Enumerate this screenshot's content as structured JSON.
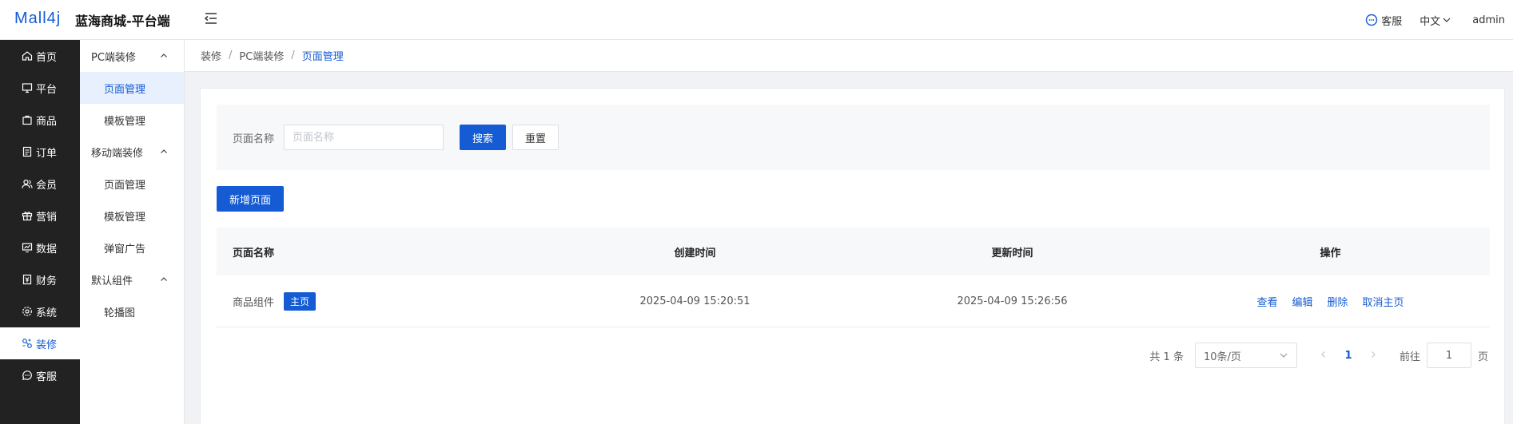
{
  "header": {
    "logo_text": "Mall4j",
    "app_title": "蓝海商城-平台端",
    "service_label": "客服",
    "language_label": "中文",
    "user_label": "admin"
  },
  "sidebar": {
    "items": [
      {
        "label": "首页",
        "icon": "home-icon"
      },
      {
        "label": "平台",
        "icon": "monitor-icon"
      },
      {
        "label": "商品",
        "icon": "bag-icon"
      },
      {
        "label": "订单",
        "icon": "document-icon"
      },
      {
        "label": "会员",
        "icon": "users-icon"
      },
      {
        "label": "营销",
        "icon": "gift-icon"
      },
      {
        "label": "数据",
        "icon": "chart-icon"
      },
      {
        "label": "财务",
        "icon": "ledger-icon"
      },
      {
        "label": "系统",
        "icon": "gear-icon"
      },
      {
        "label": "装修",
        "icon": "decorate-icon",
        "active": true
      },
      {
        "label": "客服",
        "icon": "chat-icon"
      }
    ]
  },
  "submenu": {
    "groups": [
      {
        "title": "PC端装修",
        "items": [
          "页面管理",
          "模板管理"
        ]
      },
      {
        "title": "移动端装修",
        "items": [
          "页面管理",
          "模板管理",
          "弹窗广告"
        ]
      },
      {
        "title": "默认组件",
        "items": [
          "轮播图"
        ]
      }
    ]
  },
  "breadcrumb": {
    "items": [
      "装修",
      "PC端装修",
      "页面管理"
    ],
    "separator": "/"
  },
  "search": {
    "label": "页面名称",
    "placeholder": "页面名称",
    "search_button": "搜索",
    "reset_button": "重置"
  },
  "add_button": "新增页面",
  "table": {
    "headers": [
      "页面名称",
      "创建时间",
      "更新时间",
      "操作"
    ],
    "rows": [
      {
        "name": "商品组件",
        "tag": "主页",
        "created": "2025-04-09 15:20:51",
        "updated": "2025-04-09 15:26:56",
        "actions": [
          "查看",
          "编辑",
          "删除",
          "取消主页"
        ]
      }
    ]
  },
  "pagination": {
    "total_text": "共 1 条",
    "page_size": "10条/页",
    "current_page": "1",
    "goto_label": "前往",
    "goto_value": "1",
    "page_unit": "页"
  },
  "colors": {
    "primary": "#155bd4",
    "sidebar_bg": "#222222"
  }
}
